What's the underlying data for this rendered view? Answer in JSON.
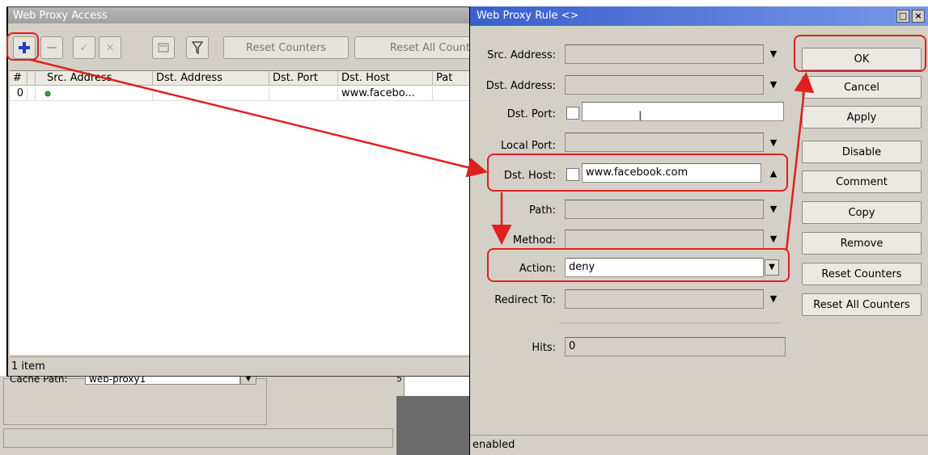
{
  "background_window": {
    "cache_label": "Cache Path:",
    "cache_value": "web-proxy1",
    "cache_arrow": "▼",
    "digit_fragment": "5"
  },
  "access_window": {
    "title": "Web Proxy Access",
    "toolbar": {
      "reset_counters": "Reset Counters",
      "reset_all_counters": "Reset All Count"
    },
    "table": {
      "headers": [
        "#",
        "Src. Address",
        "Dst. Address",
        "Dst. Port",
        "Dst. Host",
        "Pat"
      ],
      "rows": [
        {
          "index": "0",
          "src": "",
          "dst": "",
          "port": "",
          "host": "www.facebo...",
          "path": ""
        }
      ]
    },
    "status": "1 item"
  },
  "rule_dialog": {
    "title": "Web Proxy Rule <>",
    "fields": {
      "src_address": {
        "label": "Src. Address:",
        "value": ""
      },
      "dst_address": {
        "label": "Dst. Address:",
        "value": ""
      },
      "dst_port": {
        "label": "Dst. Port:",
        "value": ""
      },
      "local_port": {
        "label": "Local Port:",
        "value": ""
      },
      "dst_host": {
        "label": "Dst. Host:",
        "value": "www.facebook.com"
      },
      "path": {
        "label": "Path:",
        "value": ""
      },
      "method": {
        "label": "Method:",
        "value": ""
      },
      "action": {
        "label": "Action:",
        "value": "deny"
      },
      "redirect_to": {
        "label": "Redirect To:",
        "value": ""
      },
      "hits": {
        "label": "Hits:",
        "value": "0"
      }
    },
    "buttons": {
      "ok": "OK",
      "cancel": "Cancel",
      "apply": "Apply",
      "disable": "Disable",
      "comment": "Comment",
      "copy": "Copy",
      "remove": "Remove",
      "reset_counters": "Reset Counters",
      "reset_all_counters": "Reset All Counters"
    },
    "status": "enabled"
  },
  "colors": {
    "annotation": "#e02020",
    "title_blue": "#3a5fcd",
    "add_icon": "#1f3fbf",
    "enabled_dot": "#2ea043"
  }
}
